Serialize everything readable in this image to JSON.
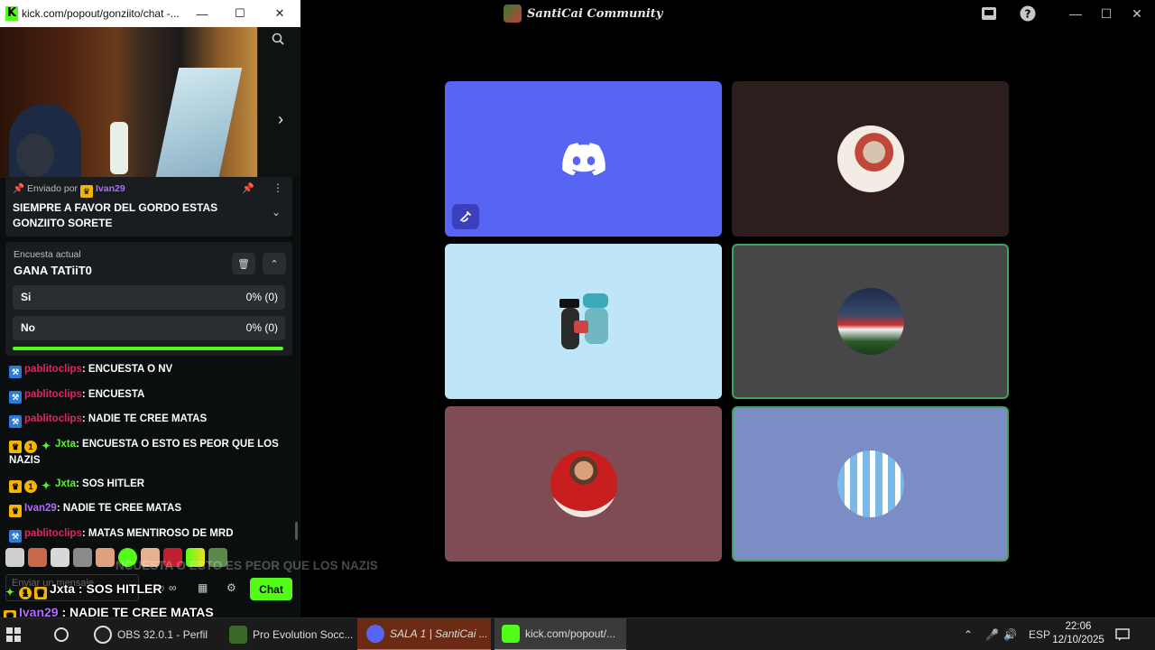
{
  "discord": {
    "title": "SantiCai Community",
    "window_controls": {
      "inbox": "inbox-icon",
      "help": "?",
      "minimize": "—",
      "maximize": "☐",
      "close": "✕"
    },
    "tiles": [
      {
        "id": "tile-discord-logo",
        "bg": "#5865f2",
        "muted": true,
        "speaking": false
      },
      {
        "id": "tile-user-2",
        "bg": "#2b1e1c",
        "speaking": false
      },
      {
        "id": "tile-user-3",
        "bg": "#bfe6f8",
        "speaking": false
      },
      {
        "id": "tile-user-4",
        "bg": "#47474a",
        "speaking": true
      },
      {
        "id": "tile-user-5",
        "bg": "#804c54",
        "speaking": false
      },
      {
        "id": "tile-user-6",
        "bg": "#7c8cc4",
        "speaking": true
      }
    ]
  },
  "kick": {
    "url": "kick.com/popout/gonziito/chat -...",
    "window_controls": {
      "minimize": "—",
      "maximize": "☐",
      "close": "✕"
    },
    "pinned": {
      "sent_by": "Enviado por",
      "user": "Ivan29",
      "message": "SIEMPRE A FAVOR DEL GORDO ESTAS GONZIITO SORETE"
    },
    "poll": {
      "label": "Encuesta actual",
      "question": "GANA TATiiT0",
      "options": [
        {
          "label": "Si",
          "result": "0% (0)"
        },
        {
          "label": "No",
          "result": "0% (0)"
        }
      ],
      "remaining_fraction": 1.0
    },
    "messages": [
      {
        "badges": [
          "mod"
        ],
        "user": "pablitoclips",
        "user_color": "#e0245e",
        "text": ": ENCUESTA O NV"
      },
      {
        "badges": [
          "mod"
        ],
        "user": "pablitoclips",
        "user_color": "#e0245e",
        "text": ": ENCUESTA"
      },
      {
        "badges": [
          "mod"
        ],
        "user": "pablitoclips",
        "user_color": "#e0245e",
        "text": ": NADIE TE CREE MATAS"
      },
      {
        "badges": [
          "crown",
          "one",
          "og"
        ],
        "user": "Jxta",
        "user_color": "#53fc18",
        "text": ": ENCUESTA O ESTO ES PEOR QUE LOS NAZIS"
      },
      {
        "badges": [
          "crown",
          "one",
          "og"
        ],
        "user": "Jxta",
        "user_color": "#53fc18",
        "text": ": SOS HITLER"
      },
      {
        "badges": [
          "crown"
        ],
        "user": "Ivan29",
        "user_color": "#b16cff",
        "text": ": NADIE TE CREE MATAS"
      },
      {
        "badges": [
          "mod"
        ],
        "user": "pablitoclips",
        "user_color": "#e0245e",
        "text": ": MATAS MENTIROSO DE MRD"
      }
    ],
    "input_placeholder": "Enviar un mensaje",
    "chat_button": "Chat"
  },
  "overlay": {
    "ghost_line": "NCUESTA O ESTO ES PEOR QUE LOS NAZIS",
    "lines": [
      {
        "user": "Jxta",
        "user_color": "#ffffff",
        "text": " : SOS HITLER"
      },
      {
        "user": "Ivan29",
        "user_color": "#b16cff",
        "text": " : NADIE TE CREE MATAS"
      },
      {
        "user": "pablitoclips",
        "user_color": "#e0245e",
        "text": " : MATAS MENTIROSO DE MRD"
      }
    ]
  },
  "taskbar": {
    "items": [
      {
        "label": "OBS 32.0.1 - Perfil"
      },
      {
        "label": "Pro Evolution Socc..."
      },
      {
        "label": "SALA 1 | SantiCai ..."
      },
      {
        "label": "kick.com/popout/..."
      }
    ],
    "language": "ESP",
    "time": "22:06",
    "date": "12/10/2025"
  }
}
